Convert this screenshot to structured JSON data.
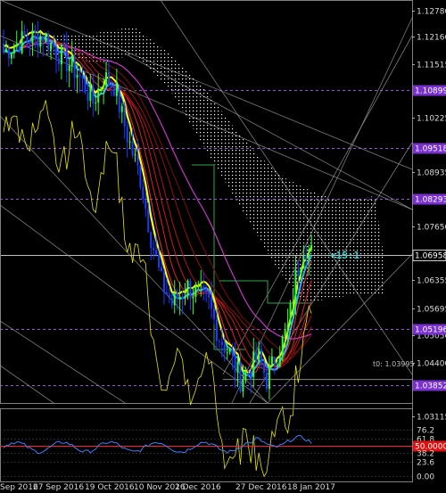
{
  "chart_data": [
    {
      "type": "candlestick",
      "instrument_hint": "EURUSD daily",
      "y_axis_labels": [
        "1.12780",
        "1.12160",
        "1.11515",
        "1.10899",
        "1.10225",
        "1.09518",
        "1.08935",
        "1.08293",
        "1.07650",
        "1.06958",
        "1.06355",
        "1.05695",
        "1.05050",
        "1.05196",
        "1.04400",
        "1.03995",
        "1.03852",
        "1.03115"
      ],
      "price_levels": [
        {
          "value": 1.1278,
          "label": "1.12780",
          "style": "plain"
        },
        {
          "value": 1.1216,
          "label": "1.12160",
          "style": "plain"
        },
        {
          "value": 1.11515,
          "label": "1.11515",
          "style": "plain"
        },
        {
          "value": 1.10899,
          "label": "1.10899",
          "style": "badge"
        },
        {
          "value": 1.10225,
          "label": "1.10225",
          "style": "plain"
        },
        {
          "value": 1.09518,
          "label": "1.09518",
          "style": "badge"
        },
        {
          "value": 1.08935,
          "label": "1.08935",
          "style": "plain"
        },
        {
          "value": 1.08293,
          "label": "1.08293",
          "style": "badge"
        },
        {
          "value": 1.0765,
          "label": "1.07650",
          "style": "plain"
        },
        {
          "value": 1.06958,
          "label": "1.06958",
          "style": "current"
        },
        {
          "value": 1.06355,
          "label": "1.06355",
          "style": "plain"
        },
        {
          "value": 1.05695,
          "label": "1.05695",
          "style": "plain"
        },
        {
          "value": 1.0505,
          "label": "1.05050",
          "style": "plain"
        },
        {
          "value": 1.05196,
          "label": "1.05196",
          "style": "badge"
        },
        {
          "value": 1.044,
          "label": "1.04400",
          "style": "plain"
        },
        {
          "value": 1.03852,
          "label": "1.03852",
          "style": "badge"
        },
        {
          "value": 1.03115,
          "label": "1.03115",
          "style": "plain"
        }
      ],
      "annotations": {
        "t0_label": "t0: 1.03995",
        "ratio_label": "<15:1"
      },
      "x_labels": [
        "Sep 2016",
        "27 Sep 2016",
        "19 Oct 2016",
        "10 Nov 2016",
        "2 Dec 2016",
        "27 Dec 2016",
        "18 Jan 2017"
      ],
      "colors": {
        "bull": "#34ff34",
        "bear": "#1a3cff",
        "level": "#9b4de0",
        "fast_ma": "#ffff00",
        "slow_ma": "#33aaff",
        "ribbon": "#ff2020"
      }
    },
    {
      "type": "line",
      "indicator_levels": [
        {
          "value": 76.2,
          "label": "76.2",
          "style": "plain"
        },
        {
          "value": 61.8,
          "label": "61.8",
          "style": "plain"
        },
        {
          "value": 50.0,
          "label": "50.0000",
          "style": "red"
        },
        {
          "value": 38.2,
          "label": "38.2",
          "style": "plain"
        },
        {
          "value": 23.6,
          "label": "23.6",
          "style": "plain"
        },
        {
          "value": 0.0,
          "label": "0.00",
          "style": "plain"
        }
      ],
      "ylim": [
        0,
        100
      ]
    }
  ]
}
